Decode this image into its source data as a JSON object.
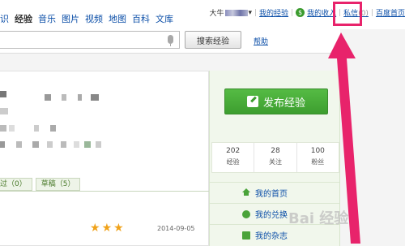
{
  "nav": {
    "items": [
      {
        "label": "识"
      },
      {
        "label": "经验",
        "current": true
      },
      {
        "label": "音乐"
      },
      {
        "label": "图片"
      },
      {
        "label": "视频"
      },
      {
        "label": "地图"
      },
      {
        "label": "百科"
      },
      {
        "label": "文库"
      }
    ]
  },
  "user": {
    "name": "大牛",
    "my_experience": "我的经验",
    "my_income": "我的收入",
    "messages": "私信",
    "messages_count": "(0)",
    "baidu_home": "百度首页"
  },
  "search": {
    "value": "",
    "button_label": "搜索经验",
    "help_label": "帮助"
  },
  "content": {
    "tabs": [
      {
        "label": "过（0）"
      },
      {
        "label": "草稿（5）"
      }
    ],
    "rating_stars": 3,
    "date": "2014-09-05"
  },
  "sidebar": {
    "publish_label": "发布经验",
    "stats": [
      {
        "value": "202",
        "label": "经验"
      },
      {
        "value": "28",
        "label": "关注"
      },
      {
        "value": "100",
        "label": "粉丝"
      }
    ],
    "menu": [
      {
        "label": "我的首页",
        "icon": "home-icon"
      },
      {
        "label": "我的兑换",
        "icon": "exchange-icon"
      },
      {
        "label": "我的杂志",
        "icon": "magazine-icon"
      }
    ]
  },
  "watermark": "Bai 经验",
  "colors": {
    "link": "#0c4fa8",
    "publish_green": "#3d9e2f",
    "highlight_pink": "#e8236b",
    "star": "#f0a21a"
  }
}
